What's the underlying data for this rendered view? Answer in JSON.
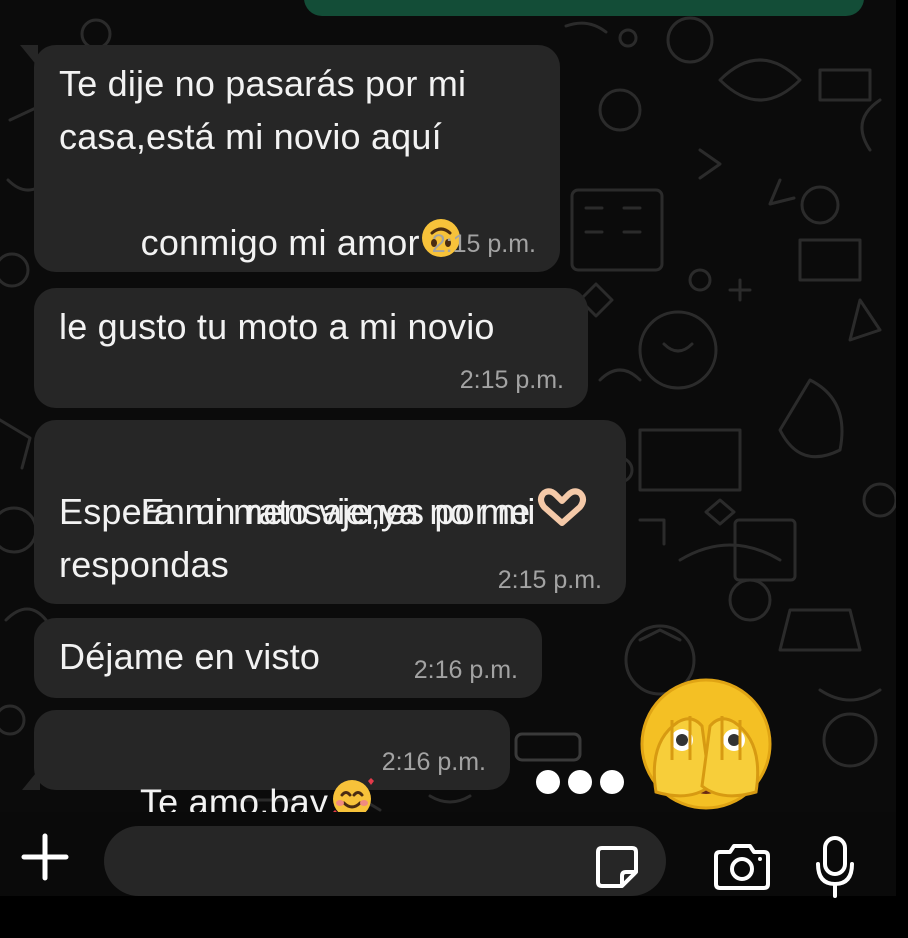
{
  "messages": [
    {
      "lines": [
        "Te dije no pasarás por mi",
        "casa,está mi novio aquí",
        "conmigo mi amor"
      ],
      "emoji": "upside-down-face",
      "time": "2:15",
      "ampm": "p.m."
    },
    {
      "lines": [
        "le gusto tu moto a mi novio"
      ],
      "time": "2:15",
      "ampm": "p.m."
    },
    {
      "lines": [
        "En un rato vienes por mi",
        "Espera mi mensaje,ya no me",
        "respondas"
      ],
      "emoji": "heart-hands",
      "time": "2:15",
      "ampm": "p.m."
    },
    {
      "lines": [
        "Déjame en visto"
      ],
      "time": "2:16",
      "ampm": "p.m."
    },
    {
      "lines": [
        "Te amo,bay"
      ],
      "emoji": "smiling-face-with-hearts",
      "time": "2:16",
      "ampm": "p.m."
    }
  ],
  "reaction": {
    "emoji": "face-with-open-eyes-and-hand-over-mouth",
    "typing_indicator": "typing-dots"
  },
  "composer": {
    "placeholder": "",
    "icons": [
      "plus-icon",
      "sticker-icon",
      "camera-icon",
      "microphone-icon"
    ]
  },
  "colors": {
    "background": "#0b0b0b",
    "bubble": "#262626",
    "outgoing": "#134d37",
    "text": "#f2f2f2",
    "time": "#a3a3a3"
  }
}
